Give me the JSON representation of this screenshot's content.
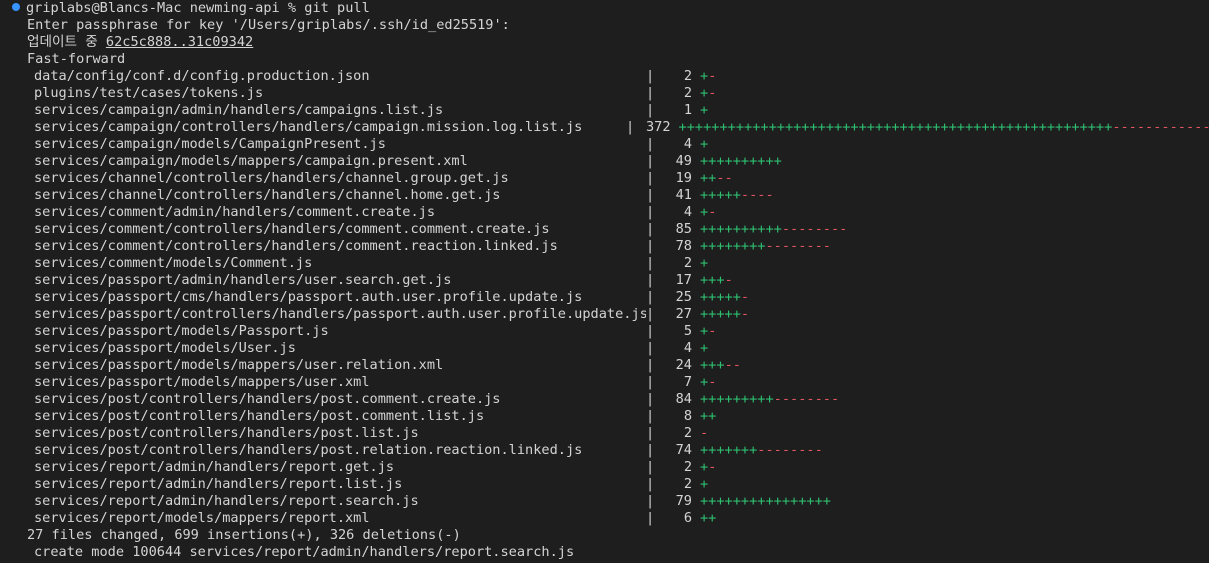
{
  "prompt": {
    "user_host": "griplabs@Blancs-Mac",
    "cwd": "newming-api",
    "symbol": "%",
    "command": "git pull"
  },
  "output": {
    "passphrase_prompt": "Enter passphrase for key '/Users/griplabs/.ssh/id_ed25519':",
    "updating_label": "업데이트 중",
    "updating_range": "62c5c888..31c09342",
    "fast_forward": "Fast-forward"
  },
  "files": [
    {
      "path": "data/config/conf.d/config.production.json",
      "changes": "2",
      "plus": "+",
      "minus": "-"
    },
    {
      "path": "plugins/test/cases/tokens.js",
      "changes": "2",
      "plus": "+",
      "minus": "-"
    },
    {
      "path": "services/campaign/admin/handlers/campaigns.list.js",
      "changes": "1",
      "plus": "+",
      "minus": ""
    },
    {
      "path": "services/campaign/controllers/handlers/campaign.mission.log.list.js",
      "changes": "372",
      "plus": "+++++++++++++++++++++++++++++++++++++++++++++++++++++",
      "minus": "--------------"
    },
    {
      "path": "services/campaign/models/CampaignPresent.js",
      "changes": "4",
      "plus": "+",
      "minus": ""
    },
    {
      "path": "services/campaign/models/mappers/campaign.present.xml",
      "changes": "49",
      "plus": "++++++++++",
      "minus": ""
    },
    {
      "path": "services/channel/controllers/handlers/channel.group.get.js",
      "changes": "19",
      "plus": "++",
      "minus": "--"
    },
    {
      "path": "services/channel/controllers/handlers/channel.home.get.js",
      "changes": "41",
      "plus": "+++++",
      "minus": "----"
    },
    {
      "path": "services/comment/admin/handlers/comment.create.js",
      "changes": "4",
      "plus": "+",
      "minus": "-"
    },
    {
      "path": "services/comment/controllers/handlers/comment.comment.create.js",
      "changes": "85",
      "plus": "++++++++++",
      "minus": "--------"
    },
    {
      "path": "services/comment/controllers/handlers/comment.reaction.linked.js",
      "changes": "78",
      "plus": "++++++++",
      "minus": "--------"
    },
    {
      "path": "services/comment/models/Comment.js",
      "changes": "2",
      "plus": "+",
      "minus": ""
    },
    {
      "path": "services/passport/admin/handlers/user.search.get.js",
      "changes": "17",
      "plus": "+++",
      "minus": "-"
    },
    {
      "path": "services/passport/cms/handlers/passport.auth.user.profile.update.js",
      "changes": "25",
      "plus": "+++++",
      "minus": "-"
    },
    {
      "path": "services/passport/controllers/handlers/passport.auth.user.profile.update.js",
      "changes": "27",
      "plus": "+++++",
      "minus": "-"
    },
    {
      "path": "services/passport/models/Passport.js",
      "changes": "5",
      "plus": "+",
      "minus": "-"
    },
    {
      "path": "services/passport/models/User.js",
      "changes": "4",
      "plus": "+",
      "minus": ""
    },
    {
      "path": "services/passport/models/mappers/user.relation.xml",
      "changes": "24",
      "plus": "+++",
      "minus": "--"
    },
    {
      "path": "services/passport/models/mappers/user.xml",
      "changes": "7",
      "plus": "+",
      "minus": "-"
    },
    {
      "path": "services/post/controllers/handlers/post.comment.create.js",
      "changes": "84",
      "plus": "+++++++++",
      "minus": "--------"
    },
    {
      "path": "services/post/controllers/handlers/post.comment.list.js",
      "changes": "8",
      "plus": "++",
      "minus": ""
    },
    {
      "path": "services/post/controllers/handlers/post.list.js",
      "changes": "2",
      "plus": "",
      "minus": "-"
    },
    {
      "path": "services/post/controllers/handlers/post.relation.reaction.linked.js",
      "changes": "74",
      "plus": "+++++++",
      "minus": "--------"
    },
    {
      "path": "services/report/admin/handlers/report.get.js",
      "changes": "2",
      "plus": "+",
      "minus": "-"
    },
    {
      "path": "services/report/admin/handlers/report.list.js",
      "changes": "2",
      "plus": "+",
      "minus": ""
    },
    {
      "path": "services/report/admin/handlers/report.search.js",
      "changes": "79",
      "plus": "++++++++++++++++",
      "minus": ""
    },
    {
      "path": "services/report/models/mappers/report.xml",
      "changes": "6",
      "plus": "++",
      "minus": ""
    }
  ],
  "summary": "27 files changed, 699 insertions(+), 326 deletions(-)",
  "create_mode": "create mode 100644 services/report/admin/handlers/report.search.js",
  "colors": {
    "background": "#1e1e1e",
    "text": "#d4d4d4",
    "insertions": "#2fbf71",
    "deletions": "#e05561",
    "prompt_dot": "#3794ff"
  }
}
